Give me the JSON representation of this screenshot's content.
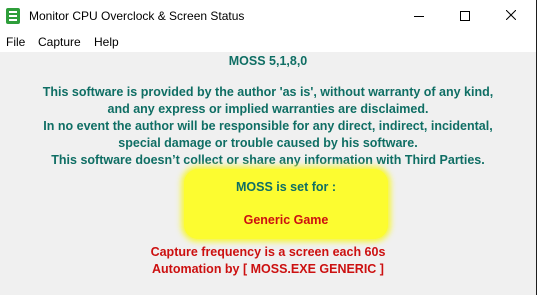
{
  "window": {
    "title": "Monitor CPU Overclock & Screen Status",
    "icon": "moss-app-icon",
    "controls": [
      "minimize-icon",
      "maximize-icon",
      "close-icon"
    ]
  },
  "menu": {
    "items": [
      "File",
      "Capture",
      "Help"
    ]
  },
  "content": {
    "version": "MOSS 5,1,8,0",
    "disclaimer_lines": [
      "This software is provided by the author 'as is', without warranty of any kind,",
      "and any express or implied warranties are disclaimed.",
      "In no event the author will be responsible for any direct, indirect, incidental,",
      "special damage or trouble caused by his software.",
      "This software doesn’t collect or share any information with Third Parties."
    ],
    "status": {
      "set_for_label": "MOSS is set for :",
      "game": "Generic Game"
    },
    "capture_frequency": "Capture frequency is a screen each 60s",
    "automation": "Automation by [ MOSS.EXE GENERIC ]"
  },
  "colors": {
    "teal_text": "#0f6e64",
    "red_text": "#cc1010",
    "highlight": "#fcfc30"
  }
}
